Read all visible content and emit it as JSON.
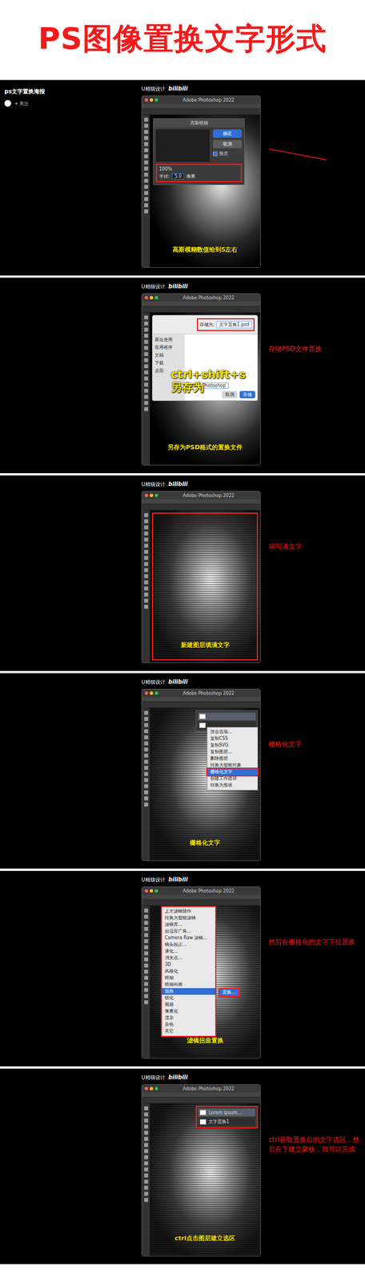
{
  "title": "PS图像置换文字形式",
  "author": {
    "name": "ps文字置换海报",
    "follow": "+ 关注"
  },
  "brand": {
    "name": "U精猫设计",
    "platform": "bilibili"
  },
  "steps": [
    {
      "canvas": "photo",
      "app_title": "Adobe Photoshop 2022",
      "caption": "高斯模糊数值给到5左右",
      "note": "",
      "arrow": true,
      "overlay": {
        "kind": "gaussian",
        "title": "高斯模糊",
        "ok": "确定",
        "cancel": "取消",
        "preview": {
          "label": "预览",
          "checked": true
        },
        "zoom": "100%",
        "radius_label": "半径:",
        "radius": "5.0",
        "unit": "像素"
      }
    },
    {
      "canvas": "photo",
      "app_title": "Adobe Photoshop 2022",
      "caption": "另存为PSD格式的置换文件",
      "note": "存储PSD文件置换",
      "arrow": false,
      "overlay": {
        "kind": "save",
        "label": "存储为:",
        "filename": "文字置换1.psd",
        "sidebar": [
          "最近使用",
          "应用程序",
          "文稿",
          "下载",
          "桌面"
        ],
        "format_label": "格式:",
        "format": "Photoshop",
        "cancel": "取消",
        "button": "存储",
        "shortcut": "ctrl+shift+s",
        "shortcut_label": "另存为"
      }
    },
    {
      "canvas": "text",
      "app_title": "Adobe Photoshop 2022",
      "caption": "新建图层填满文字",
      "note": "填写满文字",
      "arrow": false,
      "overlay": {
        "kind": "frame"
      }
    },
    {
      "canvas": "text",
      "app_title": "Adobe Photoshop 2022",
      "caption": "栅格化文字",
      "note": "栅格化文字",
      "arrow": false,
      "overlay": {
        "kind": "layer-menu",
        "items": [
          {
            "label": "混合选项...",
            "selected": false
          },
          {
            "label": "复制CSS",
            "selected": false
          },
          {
            "label": "复制SVG",
            "selected": false
          },
          {
            "label": "复制图层...",
            "selected": false
          },
          {
            "label": "删除图层",
            "selected": false
          },
          {
            "label": "转换为智能对象",
            "selected": false
          },
          {
            "label": "栅格化文字",
            "selected": true
          },
          {
            "label": "创建工作路径",
            "selected": false
          },
          {
            "label": "转换为形状",
            "selected": false
          }
        ]
      }
    },
    {
      "canvas": "text",
      "app_title": "Adobe Photoshop 2022",
      "caption": "滤镜扭曲置换",
      "note": "然后在栅格化的文字下拉置换",
      "arrow": false,
      "overlay": {
        "kind": "filter-menu",
        "submenu": "置换...",
        "items": [
          {
            "label": "上次滤镜操作",
            "selected": false
          },
          {
            "label": "转换为智能滤镜",
            "selected": false
          },
          {
            "label": "滤镜库...",
            "selected": false
          },
          {
            "label": "自适应广角...",
            "selected": false
          },
          {
            "label": "Camera Raw 滤镜...",
            "selected": false
          },
          {
            "label": "镜头校正...",
            "selected": false
          },
          {
            "label": "液化...",
            "selected": false
          },
          {
            "label": "消失点...",
            "selected": false
          },
          {
            "label": "3D",
            "selected": false
          },
          {
            "label": "风格化",
            "selected": false
          },
          {
            "label": "模糊",
            "selected": false
          },
          {
            "label": "模糊画廊",
            "selected": false
          },
          {
            "label": "扭曲",
            "selected": true
          },
          {
            "label": "锐化",
            "selected": false
          },
          {
            "label": "视频",
            "selected": false
          },
          {
            "label": "像素化",
            "selected": false
          },
          {
            "label": "渲染",
            "selected": false
          },
          {
            "label": "杂色",
            "selected": false
          },
          {
            "label": "其它",
            "selected": false
          }
        ]
      }
    },
    {
      "canvas": "text",
      "app_title": "Adobe Photoshop 2022",
      "caption": "ctrl点击图层建立选区",
      "note": "ctrl获取置换后的文字选区，然后在下建立蒙板，就可以完成",
      "arrow": false,
      "overlay": {
        "kind": "layers",
        "layers": [
          {
            "name": "Lorem ipsum...",
            "selected": true
          },
          {
            "name": "文字置换1",
            "selected": false
          }
        ]
      }
    }
  ]
}
